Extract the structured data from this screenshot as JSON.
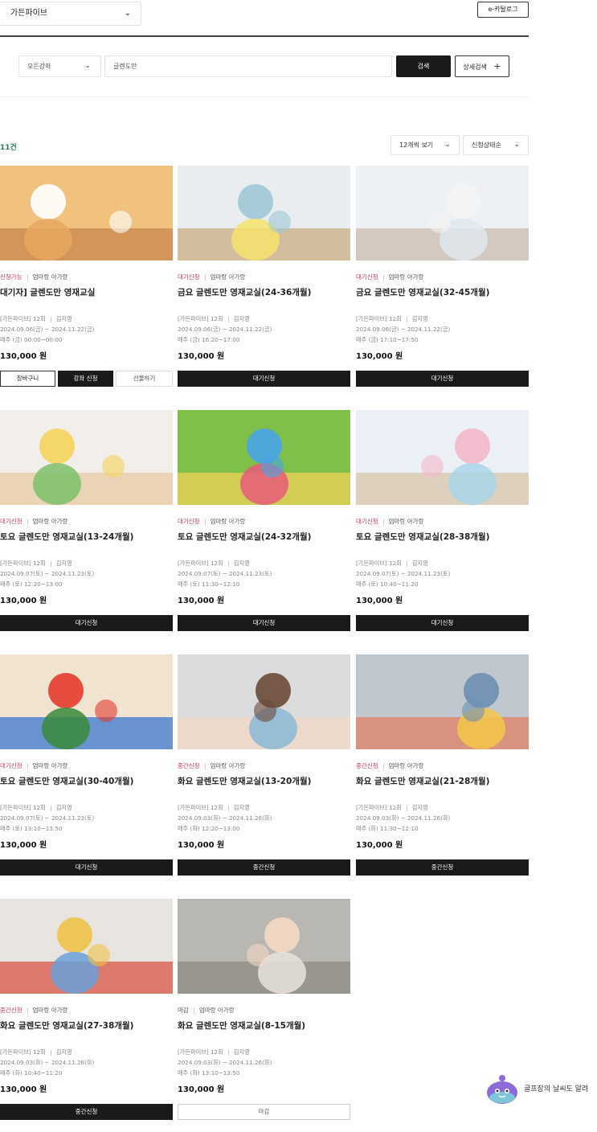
{
  "header": {
    "branch": "가든파이브",
    "ecatalog_label": "e-카탈로그"
  },
  "search": {
    "course_type": "모든강좌",
    "query": "글렌도만",
    "search_label": "검색",
    "advanced_label": "상세검색"
  },
  "results": {
    "count_label": "11건",
    "per_page": "12개씩 보기",
    "sort": "신청상태순"
  },
  "colors": {
    "status": "#d6336c",
    "count": "#2b7a5a",
    "button": "#1a1a1a"
  },
  "courses": [
    {
      "status": "신청가능",
      "category": "엄마랑 아가랑",
      "title": "대기자] 글렌도만 영재교실",
      "info": "[가든파이브] 12회",
      "teacher": "김지영",
      "period": "2024.09.06(금) ~ 2024.11.22(금)",
      "schedule": "매주 (금) 00:00~00:00",
      "price": "130,000 원",
      "buttons": [
        "장바구니",
        "강좌 신청",
        "선물하기"
      ]
    },
    {
      "status": "대기신청",
      "category": "엄마랑 아가랑",
      "title": "금요 글렌도만 영재교실(24-36개월)",
      "info": "[가든파이브] 12회",
      "teacher": "김지영",
      "period": "2024.09.06(금) ~ 2024.11.22(금)",
      "schedule": "매주 (금) 16:20~17:00",
      "price": "130,000 원",
      "button": "대기신청"
    },
    {
      "status": "대기신청",
      "category": "엄마랑 아가랑",
      "title": "금요 글렌도만 영재교실(32-45개월)",
      "info": "[가든파이브] 12회",
      "teacher": "김지영",
      "period": "2024.09.06(금) ~ 2024.11.22(금)",
      "schedule": "매주 (금) 17:10~17:50",
      "price": "130,000 원",
      "button": "대기신청"
    },
    {
      "status": "대기신청",
      "category": "엄마랑 아가랑",
      "title": "토요 글렌도만 영재교실(13-24개월)",
      "info": "[가든파이브] 12회",
      "teacher": "김지영",
      "period": "2024.09.07(토) ~ 2024.11.23(토)",
      "schedule": "매주 (토) 12:20~13:00",
      "price": "130,000 원",
      "button": "대기신청"
    },
    {
      "status": "대기신청",
      "category": "엄마랑 아가랑",
      "title": "토요 글렌도만 영재교실(24-32개월)",
      "info": "[가든파이브] 12회",
      "teacher": "김지영",
      "period": "2024.09.07(토) ~ 2024.11.23(토)",
      "schedule": "매주 (토) 11:30~12:10",
      "price": "130,000 원",
      "button": "대기신청"
    },
    {
      "status": "대기신청",
      "category": "엄마랑 아가랑",
      "title": "토요 글렌도만 영재교실(28-38개월)",
      "info": "[가든파이브] 12회",
      "teacher": "김지영",
      "period": "2024.09.07(토) ~ 2024.11.23(토)",
      "schedule": "매주 (토) 10:40~11:20",
      "price": "130,000 원",
      "button": "대기신청"
    },
    {
      "status": "대기신청",
      "category": "엄마랑 아가랑",
      "title": "토요 글렌도만 영재교실(30-40개월)",
      "info": "[가든파이브] 12회",
      "teacher": "김지영",
      "period": "2024.09.07(토) ~ 2024.11.23(토)",
      "schedule": "매주 (토) 13:10~13:50",
      "price": "130,000 원",
      "button": "대기신청"
    },
    {
      "status": "중간신청",
      "category": "엄마랑 아가랑",
      "title": "화요 글렌도만 영재교실(13-20개월)",
      "info": "[가든파이브] 12회",
      "teacher": "김지영",
      "period": "2024.09.03(화) ~ 2024.11.26(화)",
      "schedule": "매주 (화) 12:20~13:00",
      "price": "130,000 원",
      "button": "중간신청"
    },
    {
      "status": "중간신청",
      "category": "엄마랑 아가랑",
      "title": "화요 글렌도만 영재교실(21-28개월)",
      "info": "[가든파이브] 12회",
      "teacher": "김지영",
      "period": "2024.09.03(화) ~ 2024.11.26(화)",
      "schedule": "매주 (화) 11:30~12:10",
      "price": "130,000 원",
      "button": "중간신청"
    },
    {
      "status": "중간신청",
      "category": "엄마랑 아가랑",
      "title": "화요 글렌도만 영재교실(27-38개월)",
      "info": "[가든파이브] 12회",
      "teacher": "김지영",
      "period": "2024.09.03(화) ~ 2024.11.26(화)",
      "schedule": "매주 (화) 10:40~11:20",
      "price": "130,000 원",
      "button": "중간신청"
    },
    {
      "status": "마감",
      "category": "엄마랑 아가랑",
      "title": "화요 글렌도만 영재교실(8-15개월)",
      "info": "[가든파이브] 12회",
      "teacher": "김지영",
      "period": "2024.09.03(화) ~ 2024.11.26(화)",
      "schedule": "매주 (화) 13:10~13:50",
      "price": "130,000 원",
      "button": "마감"
    }
  ],
  "chatbot": {
    "text": "골프장의 날씨도 알려"
  }
}
